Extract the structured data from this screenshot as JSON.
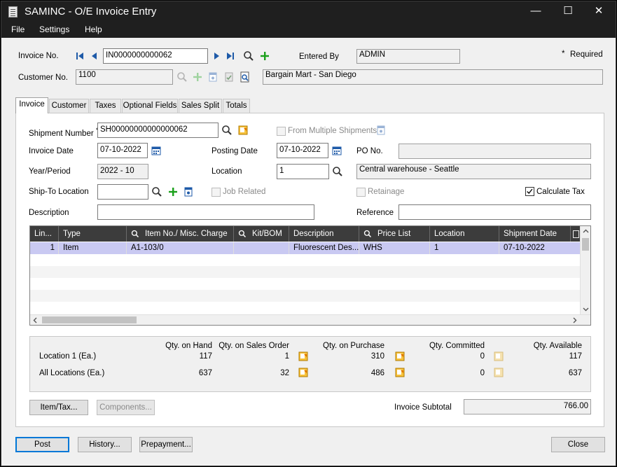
{
  "window": {
    "title": "SAMINC - O/E Invoice Entry",
    "controls": [
      "—",
      "☐",
      "✕"
    ]
  },
  "menu": [
    "File",
    "Settings",
    "Help"
  ],
  "header": {
    "invoice_no_label": "Invoice No.",
    "invoice_no_value": "IN0000000000062",
    "entered_by_label": "Entered By",
    "entered_by_value": "ADMIN",
    "required_label": "Required",
    "required_mark": "*",
    "customer_no_label": "Customer No.",
    "customer_no_value": "1100",
    "customer_name": "Bargain Mart - San Diego"
  },
  "tabs": [
    "Invoice",
    "Customer",
    "Taxes",
    "Optional Fields",
    "Sales Split",
    "Totals"
  ],
  "form": {
    "shipment_number_label": "Shipment Number",
    "shipment_number_value": "SH00000000000000062",
    "from_multiple_shipments": "From Multiple Shipments",
    "invoice_date_label": "Invoice Date",
    "invoice_date_value": "07-10-2022",
    "posting_date_label": "Posting Date",
    "posting_date_value": "07-10-2022",
    "po_no_label": "PO No.",
    "po_no_value": "",
    "year_period_label": "Year/Period",
    "year_period_value": "2022 - 10",
    "location_label": "Location",
    "location_value": "1",
    "location_desc": "Central warehouse - Seattle",
    "ship_to_label": "Ship-To Location",
    "ship_to_value": "",
    "job_related": "Job Related",
    "retainage": "Retainage",
    "calculate_tax": "Calculate Tax",
    "description_label": "Description",
    "description_value": "",
    "reference_label": "Reference",
    "reference_value": ""
  },
  "grid": {
    "columns": [
      "Lin...",
      "Type",
      "Item No./ Misc. Charge",
      "Kit/BOM",
      "Description",
      "Price List",
      "Location",
      "Shipment Date"
    ],
    "rows": [
      [
        "1",
        "Item",
        "A1-103/0",
        "",
        "Fluorescent Des...",
        "WHS",
        "1",
        "07-10-2022"
      ]
    ]
  },
  "quantities": {
    "headers": [
      "Qty. on Hand",
      "Qty. on Sales Order",
      "Qty. on Purchase",
      "Qty. Committed",
      "Qty. Available"
    ],
    "rows": [
      {
        "label": "Location  1 (Ea.)",
        "values": [
          "117",
          "1",
          "310",
          "0",
          "117"
        ]
      },
      {
        "label": "All Locations (Ea.)",
        "values": [
          "637",
          "32",
          "486",
          "0",
          "637"
        ]
      }
    ]
  },
  "buttons": {
    "item_tax": "Item/Tax...",
    "components": "Components...",
    "post": "Post",
    "history": "History...",
    "prepayment": "Prepayment...",
    "close": "Close"
  },
  "totals": {
    "invoice_subtotal_label": "Invoice Subtotal",
    "invoice_subtotal_value": "766.00"
  },
  "colors": {
    "titlebar": "#1f1f1f",
    "nav_blue": "#1e5aa8",
    "add_green": "#1aa01a",
    "selected_row": "#c9c9f2"
  }
}
